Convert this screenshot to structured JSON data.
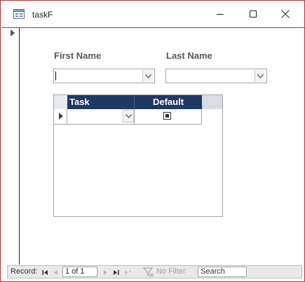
{
  "window": {
    "title": "taskF",
    "icon": "form-icon",
    "controls": [
      "minimize-icon",
      "maximize-icon",
      "close-icon"
    ]
  },
  "form": {
    "first_name_label": "First Name",
    "last_name_label": "Last Name",
    "first_name_value": "",
    "last_name_value": ""
  },
  "subform": {
    "columns": [
      "Task",
      "Default"
    ],
    "rows": [
      {
        "task": "",
        "default_checked": true
      }
    ]
  },
  "navigation": {
    "record_label": "Record:",
    "record_position": "1 of 1",
    "filter_label": "No Filter",
    "search_placeholder": "Search"
  },
  "colors": {
    "window_border": "#a4373a",
    "header_bg": "#1f3864"
  }
}
